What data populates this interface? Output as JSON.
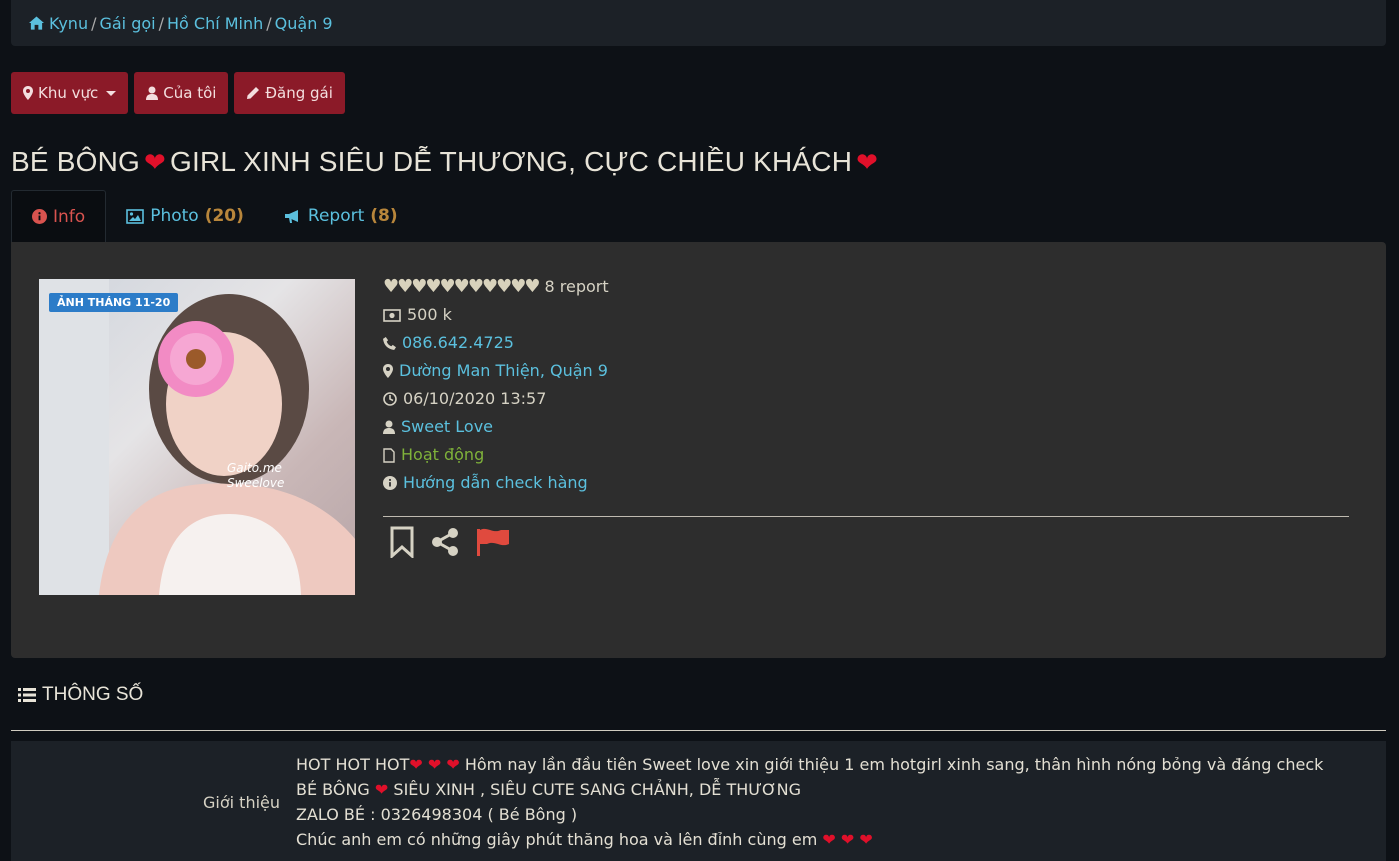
{
  "breadcrumb": {
    "items": [
      "Kynu",
      "Gái gọi",
      "Hồ Chí Minh",
      "Quận 9"
    ]
  },
  "buttons": {
    "region": "Khu vực",
    "mine": "Của tôi",
    "post": "Đăng gái"
  },
  "title": {
    "part1": "BÉ BÔNG",
    "part2": "GIRL XINH SIÊU DỄ THƯƠNG, CỰC CHIỀU KHÁCH",
    "heart": "❤"
  },
  "tabs": [
    {
      "label": "Info",
      "count": ""
    },
    {
      "label": "Photo",
      "count": "(20)"
    },
    {
      "label": "Report",
      "count": "(8)"
    }
  ],
  "profile": {
    "badge": "ẢNH THÁNG 11-20",
    "watermark_line1": "Gaito.me",
    "watermark_line2": "Sweelove",
    "hearts": "♥♥♥♥♥♥♥♥♥♥♥",
    "reports": "8 report",
    "price": "500 k",
    "phone": "086.642.4725",
    "address": "Dường Man Thiện, Quận 9",
    "datetime": "06/10/2020 13:57",
    "author": "Sweet Love",
    "status": "Hoạt động",
    "guide": "Hướng dẫn check hàng"
  },
  "section": {
    "title": "THÔNG SỐ",
    "intro_label": "Giới thiệu",
    "line1": "HOT HOT HOT",
    "line1_rest": "Hôm nay lần đầu tiên Sweet love xin giới thiệu 1 em hotgirl xinh sang, thân hình nóng bỏng và đáng check",
    "line2a": "BÉ BÔNG",
    "line2b": "SIÊU XINH , SIÊU CUTE SANG CHẢNH, DỄ THƯƠNG",
    "line3": "ZALO BÉ : 0326498304 ( Bé Bông )",
    "line4": "Chúc anh em có những giây phút thăng hoa và lên đỉnh cùng em",
    "hearts3": "❤ ❤ ❤"
  },
  "colors": {
    "accent_button": "#8b1a28",
    "link": "#5bc0de",
    "status_green": "#7fb23a",
    "heart_red": "#e0102a"
  }
}
